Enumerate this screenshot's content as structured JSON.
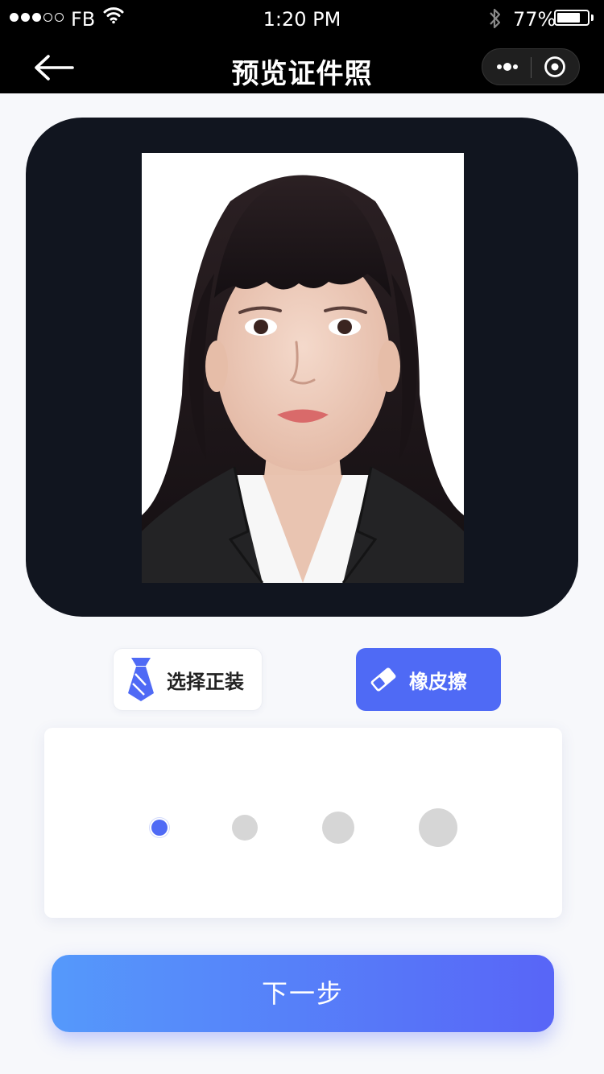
{
  "status_bar": {
    "carrier": "FB",
    "time": "1:20 PM",
    "battery_percent": "77%",
    "battery_level": 0.77,
    "signal_bars_filled": 3,
    "signal_bars_total": 5
  },
  "nav": {
    "title": "预览证件照",
    "back_icon": "arrow-left-icon",
    "more_icon": "more-dots-icon",
    "close_icon": "target-close-icon"
  },
  "photo": {
    "background_color": "#ffffff",
    "card_color": "#11151f"
  },
  "tools": {
    "suit_label": "选择正装",
    "suit_icon": "tie-icon",
    "eraser_label": "橡皮擦",
    "eraser_icon": "eraser-icon",
    "active_tool": "eraser"
  },
  "brush_sizes": {
    "count": 4,
    "selected_index": 0,
    "active_color": "#4f6af5",
    "inactive_color": "#d6d6d6"
  },
  "next_button": {
    "label": "下一步"
  },
  "colors": {
    "accent": "#4f6af5",
    "gradient_start": "#5599fb",
    "gradient_end": "#5865f7"
  }
}
